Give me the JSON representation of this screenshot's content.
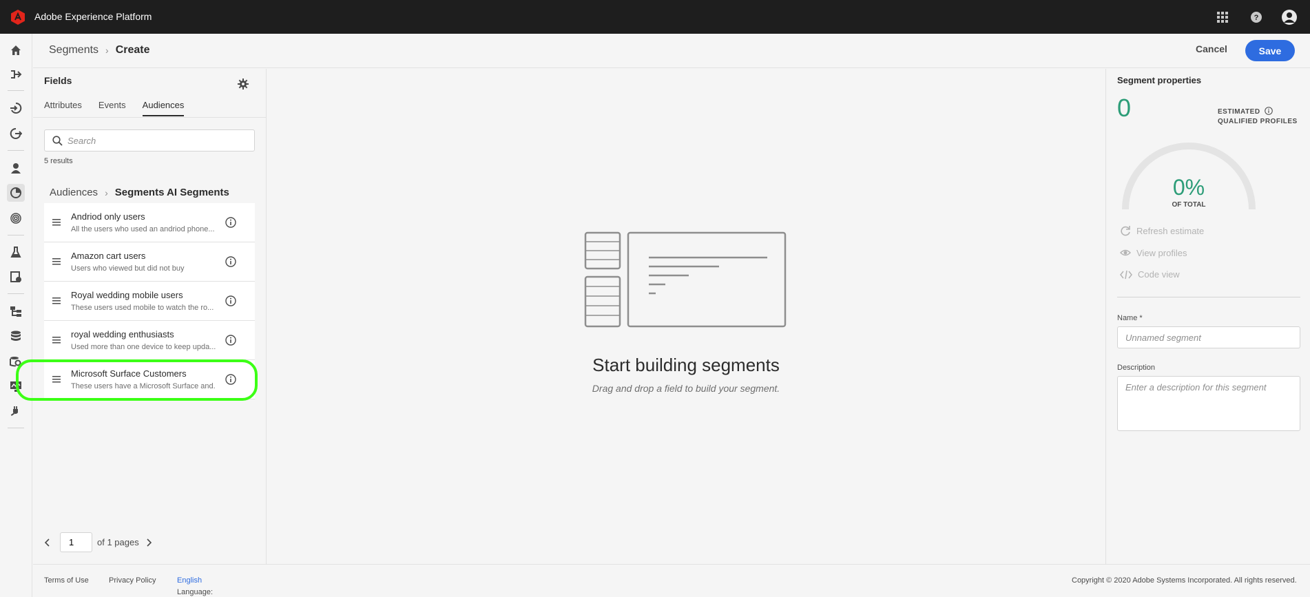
{
  "app": {
    "title": "Adobe Experience Platform"
  },
  "header": {
    "breadcrumb_parent": "Segments",
    "breadcrumb_current": "Create",
    "cancel_label": "Cancel",
    "save_label": "Save"
  },
  "fields": {
    "title": "Fields",
    "tabs": [
      {
        "label": "Attributes",
        "active": false
      },
      {
        "label": "Events",
        "active": false
      },
      {
        "label": "Audiences",
        "active": true
      }
    ],
    "search_placeholder": "Search",
    "results": "5 results",
    "audience_breadcrumb_parent": "Audiences",
    "audience_breadcrumb_current": "Segments AI Segments",
    "items": [
      {
        "title": "Andriod only users",
        "desc": "All the users who used an andriod phone..."
      },
      {
        "title": "Amazon cart users",
        "desc": "Users who viewed but did not buy"
      },
      {
        "title": "Royal wedding mobile users",
        "desc": "These users used mobile to watch the ro..."
      },
      {
        "title": "royal wedding enthusiasts",
        "desc": "Used more than one device to keep upda..."
      },
      {
        "title": "Microsoft Surface Customers",
        "desc": "These users have a Microsoft Surface and..."
      }
    ],
    "page_value": "1",
    "page_of": "of 1 pages"
  },
  "canvas": {
    "empty_title": "Start building segments",
    "empty_subtitle": "Drag and drop a field to build your segment."
  },
  "properties": {
    "title": "Segment properties",
    "estimate": "0",
    "estimated_label_1": "ESTIMATED",
    "estimated_label_2": "QUALIFIED PROFILES",
    "percent": "0%",
    "percent_label": "OF TOTAL",
    "refresh_label": "Refresh estimate",
    "view_profiles_label": "View profiles",
    "code_view_label": "Code view",
    "name_label": "Name *",
    "name_placeholder": "Unnamed segment",
    "description_label": "Description",
    "description_placeholder": "Enter a description for this segment"
  },
  "footer": {
    "terms": "Terms of Use",
    "privacy": "Privacy Policy",
    "language_label": "Language:",
    "language_value": "English",
    "copyright": "Copyright ©  2020 Adobe Systems Incorporated.  All rights reserved."
  },
  "colors": {
    "accent": "#2e6ce0",
    "highlight": "#3cff16",
    "estimate_green": "#2d9d78",
    "topbar": "#1e1e1e"
  },
  "icons": [
    "adobe-logo-icon",
    "apps-grid-icon",
    "help-icon",
    "user-avatar-icon",
    "home-icon",
    "workflows-icon",
    "sources-icon",
    "destinations-icon",
    "profiles-icon",
    "segments-icon",
    "identities-icon",
    "data-science-icon",
    "policies-icon",
    "schemas-icon",
    "datasets-icon",
    "queries-icon",
    "monitoring-icon",
    "plugins-icon",
    "settings-gear-icon",
    "search-icon",
    "drag-handle-icon",
    "info-icon",
    "refresh-icon",
    "eye-icon",
    "code-icon"
  ]
}
